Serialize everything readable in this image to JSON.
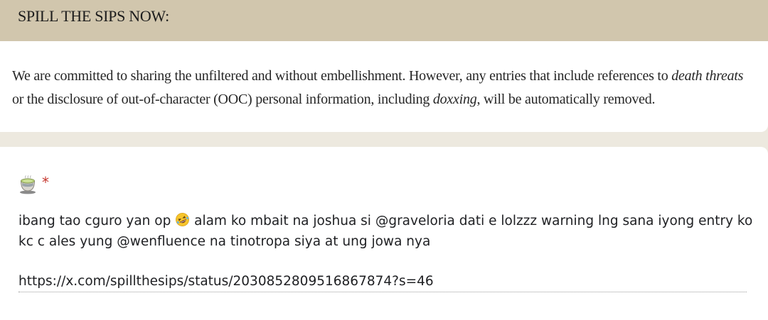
{
  "header": {
    "title": "SPILL THE SIPS NOW:"
  },
  "description": {
    "part1": "We are committed to sharing the unfiltered and without embellishment. However, any entries that include references to ",
    "em1": "death threats",
    "part2": " or the disclosure of out-of-character (OOC) personal information, including ",
    "em2": "doxxing",
    "part3": ", will be automatically removed."
  },
  "question": {
    "icon": "tea-cup-icon",
    "required_marker": "*",
    "answer": {
      "line1_before_emoji": "ibang tao cguro yan op ",
      "emoji": "rofl-emoji",
      "line1_after_emoji": " alam ko mbait na joshua si @graveloria dati e lolzzz warning lng sana iyong entry ko",
      "line2": "kc c ales yung @wenfluence na tinotropa siya at ung jowa nya",
      "link": "https://x.com/spillthesips/status/2030852809516867874?s=46"
    }
  },
  "colors": {
    "header_bg": "#d1c6ad",
    "page_bg": "#ede9df",
    "required_star": "#c5362d"
  }
}
